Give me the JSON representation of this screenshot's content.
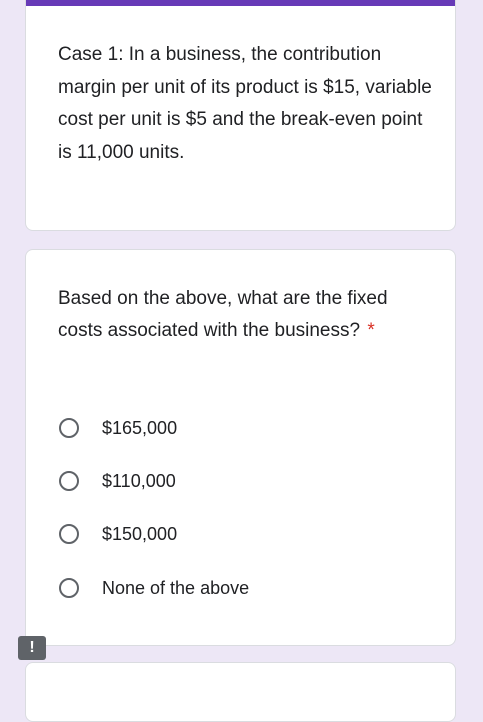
{
  "colors": {
    "accent": "#673ab7",
    "page_background": "#ede7f6",
    "required_star": "#d93025"
  },
  "case_card": {
    "text": "Case 1: In a business, the contribution margin per unit of its product is $15, variable cost per unit is $5 and the break-even point is 11,000 units."
  },
  "question_card": {
    "question": "Based on the above, what are the fixed costs associated with the business?",
    "required_marker": "*",
    "options": [
      {
        "label": "$165,000"
      },
      {
        "label": "$110,000"
      },
      {
        "label": "$150,000"
      },
      {
        "label": "None of the above"
      }
    ]
  },
  "report_button": {
    "icon": "report-problem-icon",
    "glyph": "!"
  }
}
